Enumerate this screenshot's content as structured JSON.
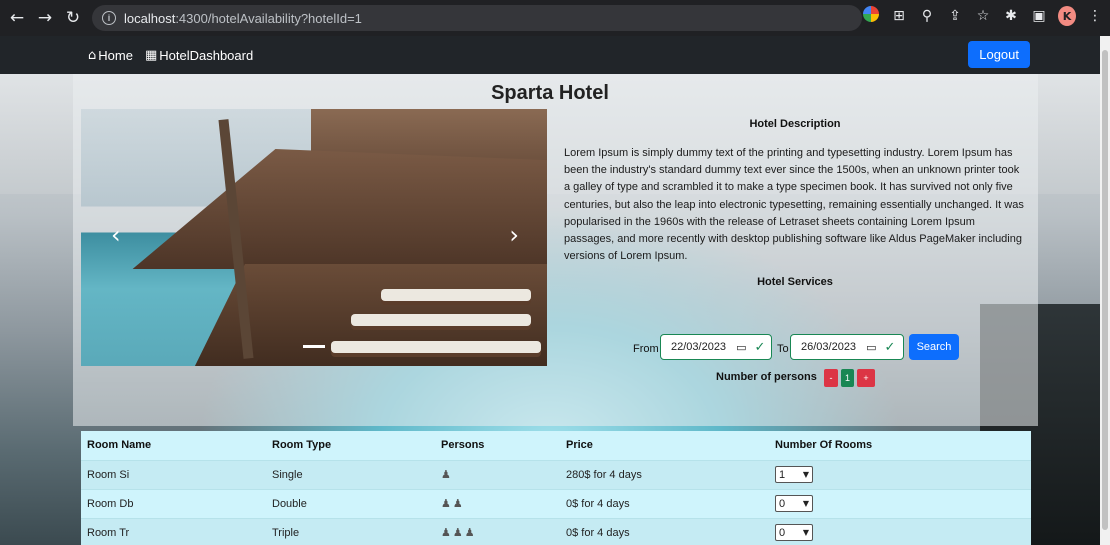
{
  "browser": {
    "url_host": "localhost",
    "url_rest": ":4300/hotelAvailability?hotelId=1",
    "profile_initial": "K"
  },
  "navbar": {
    "home_label": "Home",
    "dashboard_label": "HotelDashboard",
    "logout_label": "Logout"
  },
  "hotel": {
    "title": "Sparta Hotel",
    "description_heading": "Hotel Description",
    "description": "Lorem Ipsum is simply dummy text of the printing and typesetting industry. Lorem Ipsum has been the industry's standard dummy text ever since the 1500s, when an unknown printer took a galley of type and scrambled it to make a type specimen book. It has survived not only five centuries, but also the leap into electronic typesetting, remaining essentially unchanged. It was popularised in the 1960s with the release of Letraset sheets containing Lorem Ipsum passages, and more recently with desktop publishing software like Aldus PageMaker including versions of Lorem Ipsum.",
    "services_heading": "Hotel Services"
  },
  "search": {
    "from_label": "From",
    "from_date": "22/03/2023",
    "to_label": "To",
    "to_date": "26/03/2023",
    "search_label": "Search",
    "persons_label": "Number of persons",
    "decrement_label": "-",
    "persons_count": "1",
    "increment_label": "+"
  },
  "table": {
    "headers": [
      "Room Name",
      "Room Type",
      "Persons",
      "Price",
      "Number Of Rooms"
    ],
    "rows": [
      {
        "name": "Room Si",
        "type": "Single",
        "persons": "♟",
        "price": "280$ for 4 days",
        "count": "1"
      },
      {
        "name": "Room Db",
        "type": "Double",
        "persons": "♟♟",
        "price": "0$ for 4 days",
        "count": "0"
      },
      {
        "name": "Room Tr",
        "type": "Triple",
        "persons": "♟♟♟",
        "price": "0$ for 4 days",
        "count": "0"
      }
    ]
  },
  "colors": {
    "navbar": "#212529",
    "primary": "#0d6efd",
    "success": "#198754",
    "danger": "#dc3545",
    "table_bg": "#cff4fc"
  }
}
